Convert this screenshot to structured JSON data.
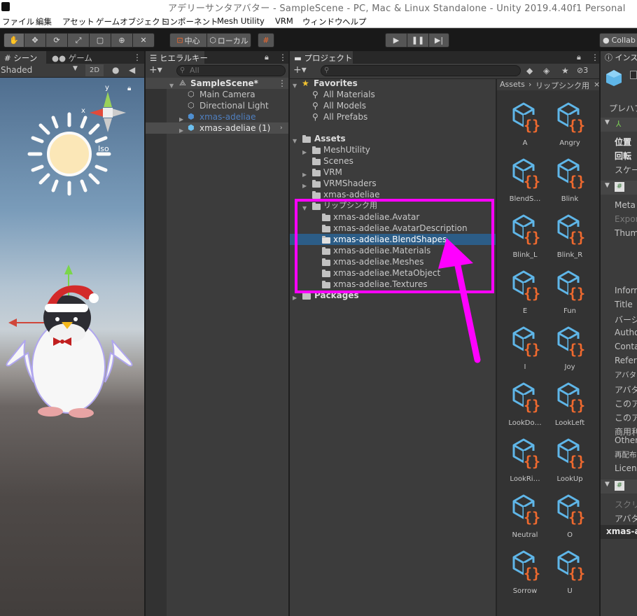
{
  "window": {
    "title": "アデリーサンタアバター - SampleScene - PC, Mac & Linux Standalone - Unity 2019.4.40f1 Personal"
  },
  "menu": [
    "ファイル",
    "編集",
    "アセット",
    "ゲームオブジェクト",
    "コンポーネント",
    "Mesh Utility",
    "VRM",
    "ウィンドウ",
    "ヘルプ"
  ],
  "toolbar": {
    "pivot": "中心",
    "space": "ローカル",
    "collab": "Collab"
  },
  "scene_panel": {
    "tabs": [
      "シーン",
      "ゲーム"
    ],
    "shading": "Shaded",
    "mode_2d": "2D",
    "gizmo_x": "x",
    "gizmo_y": "y",
    "projection": "Iso"
  },
  "hierarchy": {
    "tab": "ヒエラルキー",
    "search_placeholder": "All",
    "scene": "SampleScene*",
    "items": [
      "Main Camera",
      "Directional Light",
      "xmas-adeliae",
      "xmas-adeliae (1)"
    ]
  },
  "project": {
    "tab": "プロジェクト",
    "favorites": {
      "label": "Favorites",
      "items": [
        "All Materials",
        "All Models",
        "All Prefabs"
      ]
    },
    "assets": {
      "label": "Assets",
      "folders": [
        "MeshUtility",
        "Scenes",
        "VRM",
        "VRMShaders",
        "xmas-adeliae"
      ],
      "lip_folder": "リップシンク用",
      "lip_children": [
        "xmas-adeliae.Avatar",
        "xmas-adeliae.AvatarDescription",
        "xmas-adeliae.BlendShapes",
        "xmas-adeliae.Materials",
        "xmas-adeliae.Meshes",
        "xmas-adeliae.MetaObject",
        "xmas-adeliae.Textures"
      ]
    },
    "packages": "Packages",
    "hidden_count": "3",
    "breadcrumb": [
      "Assets",
      "リップシンク用"
    ],
    "grid_items": [
      "A",
      "Angry",
      "BlendS…",
      "Blink",
      "Blink_L",
      "Blink_R",
      "E",
      "Fun",
      "I",
      "Joy",
      "LookDo…",
      "LookLeft",
      "LookRi…",
      "LookUp",
      "Neutral",
      "O",
      "Sorrow",
      "U"
    ]
  },
  "inspector": {
    "tab": "インス",
    "rows": [
      "プレハブ",
      "位置",
      "回転",
      "スケール",
      "Meta",
      "Expor",
      "Thum",
      "Inform",
      "Title",
      "バージ",
      "Autho",
      "Conta",
      "Refer",
      "アバター",
      "アバター",
      "このア",
      "このア",
      "商用利",
      "Other",
      "再配布",
      "Licens",
      "スクリプ",
      "アバター",
      "xmas-a"
    ]
  },
  "colors": {
    "highlight": "#ff00ff",
    "selection": "#2c5d87",
    "icon_cube": "#5fb6e8",
    "icon_brace": "#f06a2f"
  }
}
